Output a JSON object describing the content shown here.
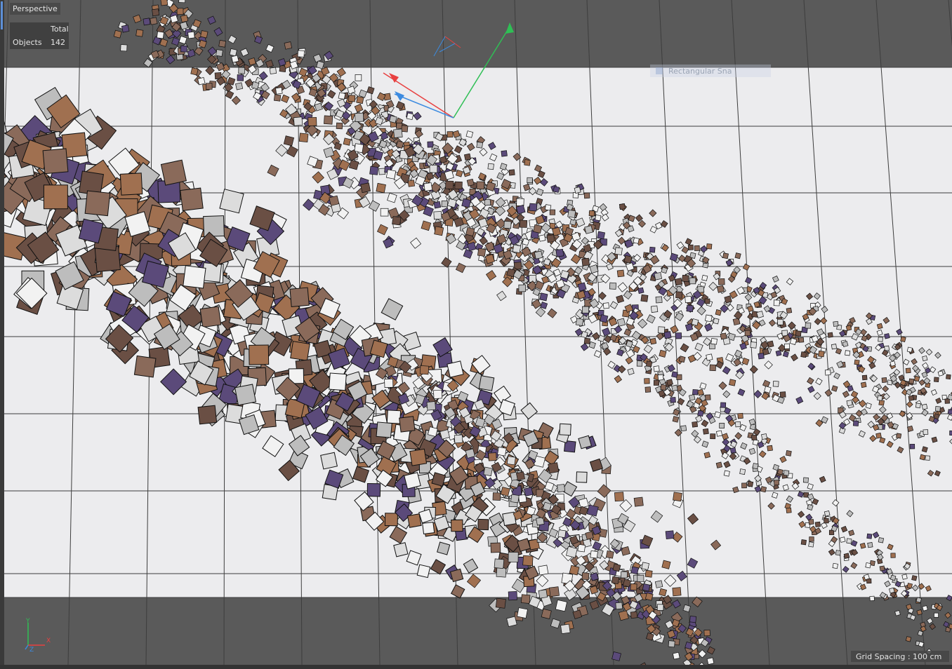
{
  "viewport": {
    "name": "Perspective",
    "hud": {
      "header": "Total",
      "row_label": "Objects",
      "row_value": "142"
    },
    "snap_hint": "Rectangular Sna",
    "grid_spacing": "Grid Spacing : 100 cm",
    "axis_labels": {
      "x": "X",
      "y": "Y",
      "z": "Z"
    },
    "colors": {
      "floor": "#ececee",
      "backdrop": "#5a5a5a",
      "grid_line": "#3d3d3d",
      "axis_x": "#e84040",
      "axis_y": "#2fbf55",
      "axis_z": "#3c8be0"
    }
  }
}
